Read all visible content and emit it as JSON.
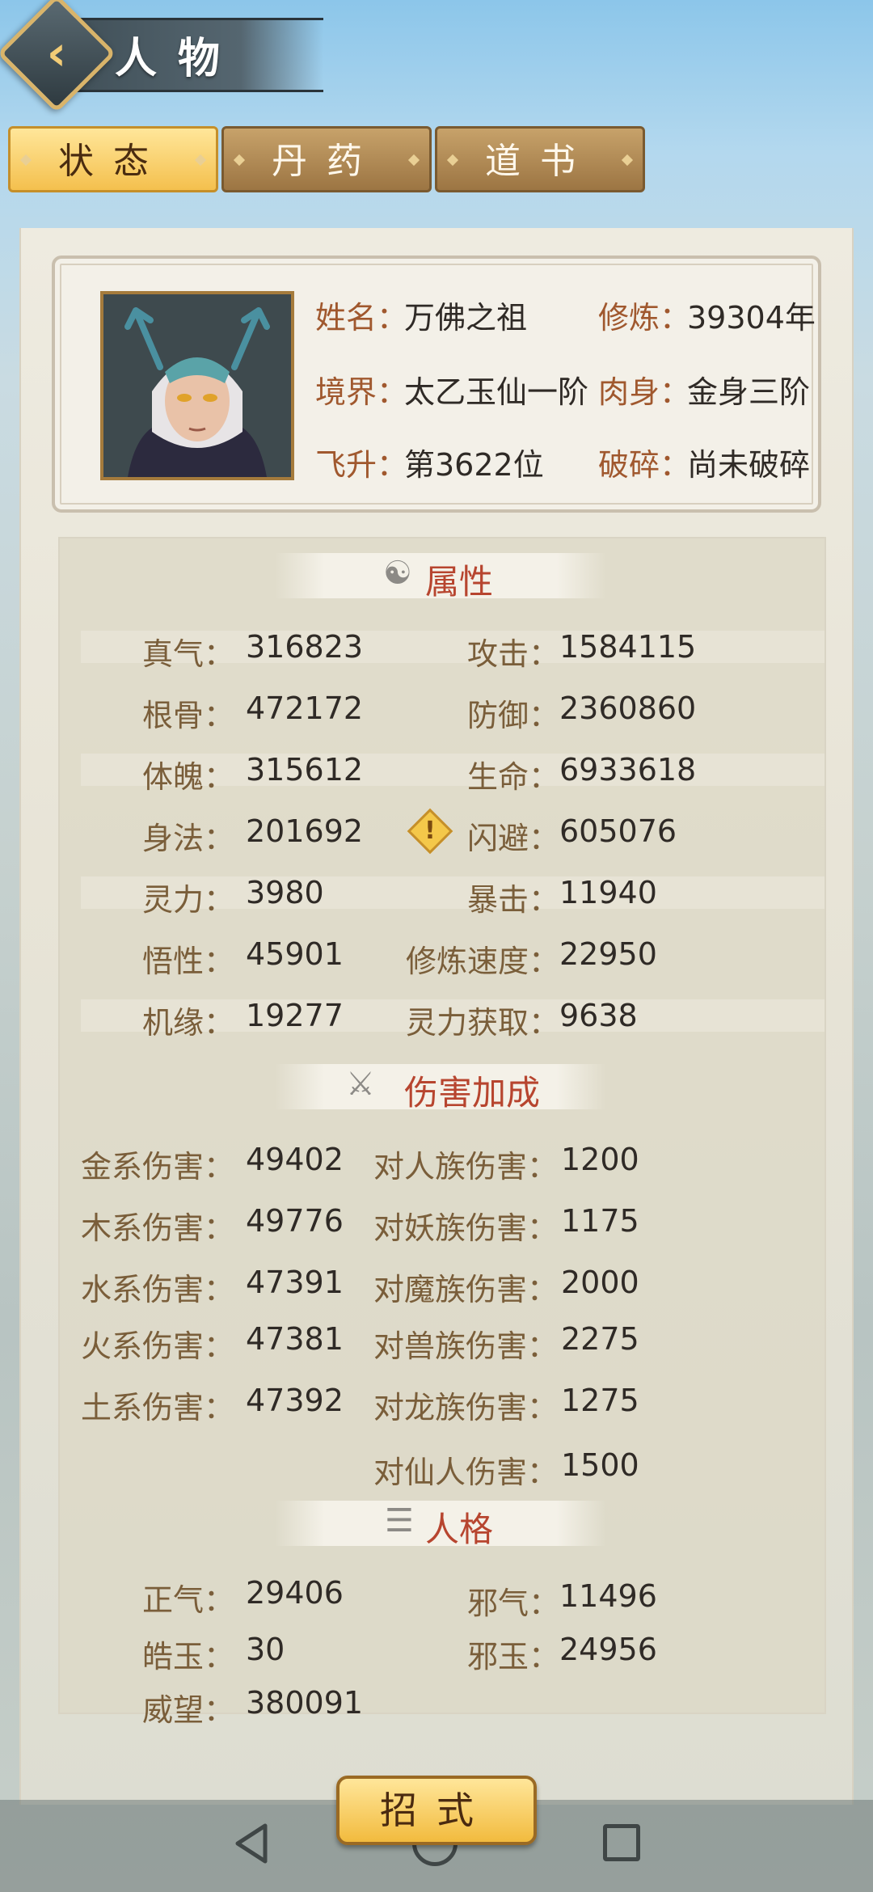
{
  "header": {
    "title": "人物"
  },
  "tabs": [
    {
      "label": "状态",
      "active": true
    },
    {
      "label": "丹药",
      "active": false
    },
    {
      "label": "道书",
      "active": false
    }
  ],
  "profile": {
    "name_label": "姓名：",
    "name": "万佛之祖",
    "cultivation_label": "修炼：",
    "cultivation": "39304年",
    "realm_label": "境界：",
    "realm": "太乙玉仙一阶",
    "body_label": "肉身：",
    "body": "金身三阶",
    "ascend_label": "飞升：",
    "ascend": "第3622位",
    "shatter_label": "破碎：",
    "shatter": "尚未破碎"
  },
  "attributes": {
    "title": "属性",
    "rows": [
      {
        "l_label": "真气：",
        "l_value": "316823",
        "r_label": "攻击：",
        "r_value": "1584115"
      },
      {
        "l_label": "根骨：",
        "l_value": "472172",
        "r_label": "防御：",
        "r_value": "2360860"
      },
      {
        "l_label": "体魄：",
        "l_value": "315612",
        "r_label": "生命：",
        "r_value": "6933618"
      },
      {
        "l_label": "身法：",
        "l_value": "201692",
        "r_label": "闪避：",
        "r_value": "605076"
      },
      {
        "l_label": "灵力：",
        "l_value": "3980",
        "r_label": "暴击：",
        "r_value": "11940"
      },
      {
        "l_label": "悟性：",
        "l_value": "45901",
        "r_label": "修炼速度：",
        "r_value": "22950"
      },
      {
        "l_label": "机缘：",
        "l_value": "19277",
        "r_label": "灵力获取：",
        "r_value": "9638"
      }
    ]
  },
  "damage": {
    "title": "伤害加成",
    "left": [
      {
        "label": "金系伤害：",
        "value": "49402"
      },
      {
        "label": "木系伤害：",
        "value": "49776"
      },
      {
        "label": "水系伤害：",
        "value": "47391"
      },
      {
        "label": "火系伤害：",
        "value": "47381"
      },
      {
        "label": "土系伤害：",
        "value": "47392"
      }
    ],
    "right": [
      {
        "label": "对人族伤害：",
        "value": "1200"
      },
      {
        "label": "对妖族伤害：",
        "value": "1175"
      },
      {
        "label": "对魔族伤害：",
        "value": "2000"
      },
      {
        "label": "对兽族伤害：",
        "value": "2275"
      },
      {
        "label": "对龙族伤害：",
        "value": "1275"
      },
      {
        "label": "对仙人伤害：",
        "value": "1500"
      }
    ]
  },
  "personality": {
    "title": "人格",
    "rows": [
      {
        "l_label": "正气：",
        "l_value": "29406",
        "r_label": "邪气：",
        "r_value": "11496"
      },
      {
        "l_label": "皓玉：",
        "l_value": "30",
        "r_label": "邪玉：",
        "r_value": "24956"
      },
      {
        "l_label": "威望：",
        "l_value": "380091"
      }
    ]
  },
  "footer": {
    "skills_button": "招式"
  },
  "icons": {
    "back": "chevron-left-icon",
    "attributes": "yin-yang-icon",
    "damage": "crossed-swords-icon",
    "personality": "book-icon",
    "warning": "warning-icon"
  },
  "colors": {
    "accent_red": "#b7452f",
    "label_brown": "#a0582e",
    "tab_gold": "#f4c04e"
  }
}
